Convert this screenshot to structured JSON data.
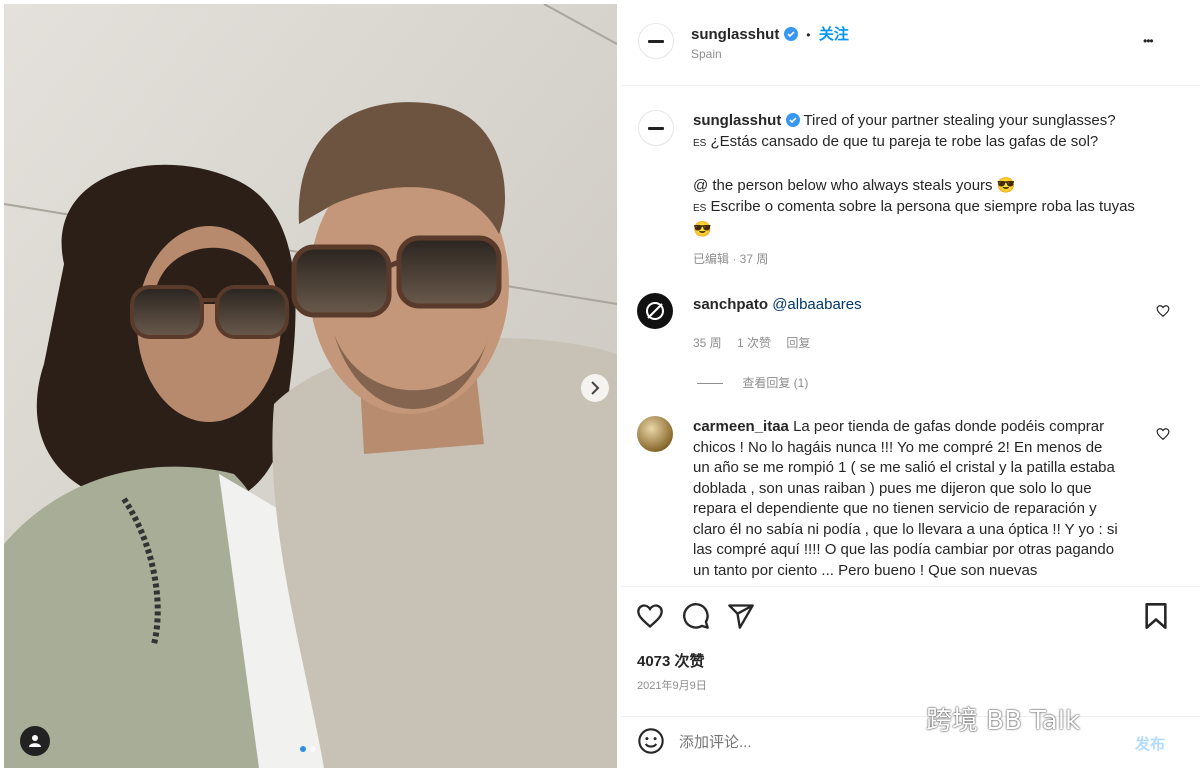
{
  "post": {
    "account": "sunglasshut",
    "follow_label": "关注",
    "separator": "•",
    "location": "Spain",
    "more_label": "•••"
  },
  "caption": {
    "username": "sunglasshut",
    "line1": "Tired of your partner stealing your sunglasses?",
    "line2_prefix": "ES",
    "line2": "¿Estás cansado de que tu pareja te robe las gafas de sol?",
    "line3": "@ the person below who always steals yours 😎",
    "line4_prefix": "ES",
    "line4": "Escribe o comenta sobre la persona que siempre roba las tuyas",
    "line5": "😎",
    "meta": "已编辑 · 37 周"
  },
  "comments": [
    {
      "username": "sanchpato",
      "text": "@albaabares",
      "age": "35 周",
      "likes": "1 次赞",
      "reply_label": "回复",
      "view_replies": "查看回复 (1)"
    },
    {
      "username": "carmeen_itaa",
      "lines": [
        "La peor tienda de gafas donde podéis comprar",
        "chicos ! No lo hagáis nunca !!! Yo me compré 2! En menos de",
        "un año se me rompió 1 ( se me salió el cristal y la patilla estaba",
        "doblada , son unas raiban ) pues me dijeron que solo lo que",
        "repara el dependiente que no tienen servicio de reparación y",
        "claro él no sabía ni podía , que lo llevara a una óptica !! Y yo : si",
        "las compré aquí !!!! O que las podía cambiar por otras pagando",
        "un tanto por ciento ... Pero bueno ! Que son nuevas"
      ]
    }
  ],
  "stats": {
    "likes": "4073 次赞",
    "date": "2021年9月9日"
  },
  "composer": {
    "placeholder": "添加评论...",
    "post_label": "发布"
  },
  "watermark": "跨境 BB Talk",
  "colors": {
    "accent": "#0095f6",
    "verified": "#3897f0",
    "carousel_active_dot": "#2f8fe8"
  }
}
